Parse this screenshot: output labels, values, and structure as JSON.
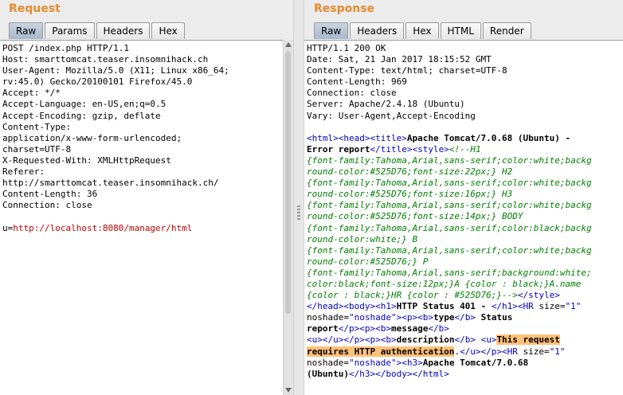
{
  "request": {
    "title": "Request",
    "tabs": [
      "Raw",
      "Params",
      "Headers",
      "Hex"
    ],
    "active_tab": "Raw",
    "lines": [
      "POST /index.php HTTP/1.1",
      "Host: smarttomcat.teaser.insomnihack.ch",
      "User-Agent: Mozilla/5.0 (X11; Linux x86_64;",
      "rv:45.0) Gecko/20100101 Firefox/45.0",
      "Accept: */*",
      "Accept-Language: en-US,en;q=0.5",
      "Accept-Encoding: gzip, deflate",
      "Content-Type:",
      "application/x-www-form-urlencoded;",
      "charset=UTF-8",
      "X-Requested-With: XMLHttpRequest",
      "Referer:",
      "http://smarttomcat.teaser.insomnihack.ch/",
      "Content-Length: 36",
      "Connection: close",
      ""
    ],
    "body_param_name": "u",
    "body_param_eq": "=",
    "body_param_value": "http://localhost:8080/manager/html"
  },
  "response": {
    "title": "Response",
    "tabs": [
      "Raw",
      "Headers",
      "Hex",
      "HTML",
      "Render"
    ],
    "active_tab": "Raw",
    "header_lines": [
      "HTTP/1.1 200 OK",
      "Date: Sat, 21 Jan 2017 18:15:52 GMT",
      "Content-Type: text/html; charset=UTF-8",
      "Content-Length: 969",
      "Connection: close",
      "Server: Apache/2.4.18 (Ubuntu)",
      "Vary: User-Agent,Accept-Encoding",
      ""
    ],
    "html": {
      "l1_a": "<html><head><title>",
      "l1_title": "Apache Tomcat/7.0.68 (Ubuntu) -",
      "l2_title": "Error report",
      "l2_b": "</title><style>",
      "l2_c": "<!--H1",
      "css_lines": [
        "{font-family:Tahoma,Arial,sans-serif;color:white;backg",
        "round-color:#525D76;font-size:22px;} H2",
        "{font-family:Tahoma,Arial,sans-serif;color:white;backg",
        "round-color:#525D76;font-size:16px;} H3",
        "{font-family:Tahoma,Arial,sans-serif;color:white;backg",
        "round-color:#525D76;font-size:14px;} BODY",
        "{font-family:Tahoma,Arial,sans-serif;color:black;backg",
        "round-color:white;} B",
        "{font-family:Tahoma,Arial,sans-serif;color:white;backg",
        "round-color:#525D76;} P",
        "{font-family:Tahoma,Arial,sans-serif;background:white;",
        "color:black;font-size:12px;}A {color : black;}A.name",
        "{color : black;}HR {color : #525D76;}-->"
      ],
      "style_close": "</style>",
      "l16_a": "</head><body><h1>",
      "l16_b": "HTTP Status 401 - ",
      "l16_c": "</h1><HR ",
      "l16_attr": "size",
      "l16_eq": "=",
      "l16_val": "\"1\"",
      "l17_attr": "noshade",
      "l17_eq": "=",
      "l17_val": "\"noshade\"",
      "l17_a": "><p><b>",
      "l17_b": "type",
      "l17_c": "</b> ",
      "l17_d": "Status",
      "l18_a": "report",
      "l18_b": "</p><p><b>",
      "l18_c": "message",
      "l18_d": "</b>",
      "l19_a": "<u></u></p><p><b>",
      "l19_b": "description",
      "l19_c": "</b> <u>",
      "l19_hl": "This request",
      "l20_hl": "requires HTTP authentication",
      "l20_a": ".",
      "l20_b": "</u></p><HR ",
      "l20_attr": "size",
      "l20_eq": "=",
      "l20_val": "\"1\"",
      "l21_attr": "noshade",
      "l21_eq": "=",
      "l21_val": "\"noshade\"",
      "l21_a": "><h3>",
      "l21_b": "Apache Tomcat/7.0.68",
      "l22_a": "(Ubuntu)",
      "l22_b": "</h3></body></html>"
    }
  }
}
